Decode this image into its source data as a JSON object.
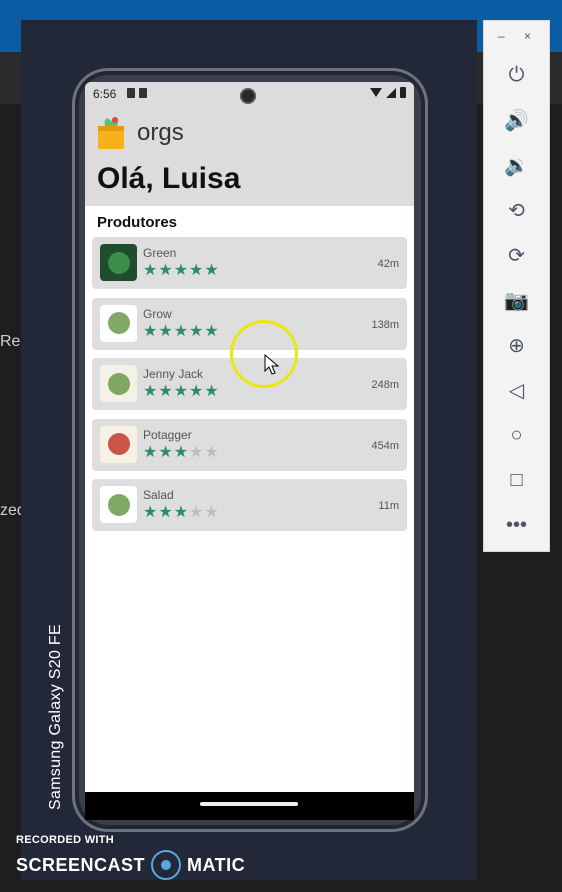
{
  "desktop": {
    "side_text_1": "Rei",
    "side_text_2": "zed"
  },
  "emulator": {
    "device_label": "Samsung Galaxy S20 FE",
    "toolbar": {
      "minimize": "–",
      "close": "×",
      "buttons": [
        {
          "name": "power-icon",
          "glyph": "⏻"
        },
        {
          "name": "volume-up-icon",
          "glyph": "🔊"
        },
        {
          "name": "volume-down-icon",
          "glyph": "🔉"
        },
        {
          "name": "rotate-left-icon",
          "glyph": "⟲"
        },
        {
          "name": "rotate-right-icon",
          "glyph": "⟳"
        },
        {
          "name": "camera-icon",
          "glyph": "📷"
        },
        {
          "name": "zoom-icon",
          "glyph": "⊕"
        },
        {
          "name": "back-icon",
          "glyph": "◁"
        },
        {
          "name": "home-icon",
          "glyph": "○"
        },
        {
          "name": "overview-icon",
          "glyph": "□"
        },
        {
          "name": "more-icon",
          "glyph": "•••"
        }
      ]
    }
  },
  "status_bar": {
    "time": "6:56"
  },
  "app": {
    "brand": "orgs",
    "greeting": "Olá, Luisa",
    "section_title": "Produtores",
    "producers": [
      {
        "name": "Green",
        "distance": "42m",
        "rating": 5,
        "thumb_color": "#1f4d2e"
      },
      {
        "name": "Grow",
        "distance": "138m",
        "rating": 5,
        "thumb_color": "#ffffff"
      },
      {
        "name": "Jenny Jack",
        "distance": "248m",
        "rating": 5,
        "thumb_color": "#f4f1e6"
      },
      {
        "name": "Potagger",
        "distance": "454m",
        "rating": 3,
        "thumb_color": "#f6f1e3"
      },
      {
        "name": "Salad",
        "distance": "11m",
        "rating": 3,
        "thumb_color": "#ffffff"
      }
    ]
  },
  "watermark": {
    "line1": "RECORDED WITH",
    "line2a": "SCREENCAST",
    "line2b": "MATIC"
  },
  "colors": {
    "star_on": "#2e8b6b",
    "star_off": "#bdbdbd",
    "card_bg": "#dedede"
  }
}
